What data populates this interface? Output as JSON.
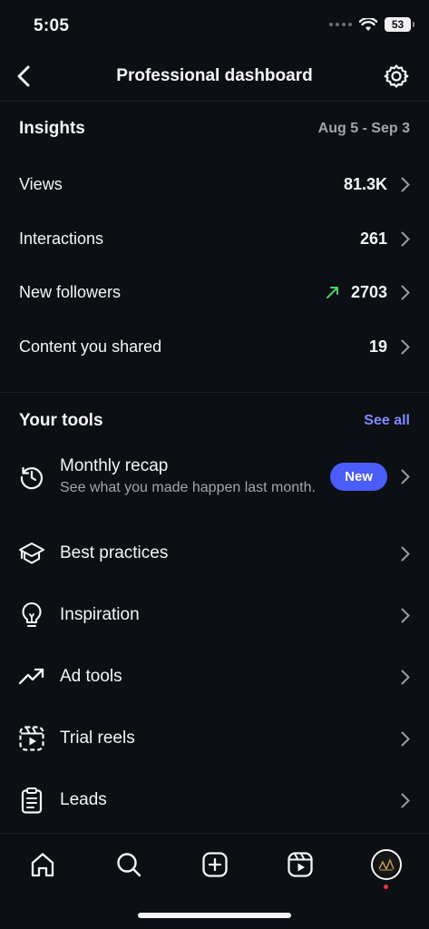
{
  "status_bar": {
    "time": "5:05",
    "battery": "53"
  },
  "header": {
    "title": "Professional dashboard"
  },
  "insights": {
    "title": "Insights",
    "date_range": "Aug 5 - Sep 3",
    "metrics": [
      {
        "label": "Views",
        "value": "81.3K"
      },
      {
        "label": "Interactions",
        "value": "261"
      },
      {
        "label": "New followers",
        "value": "2703",
        "trend": "up"
      },
      {
        "label": "Content you shared",
        "value": "19"
      }
    ]
  },
  "tools": {
    "title": "Your tools",
    "see_all": "See all",
    "items": [
      {
        "label": "Monthly recap",
        "subtitle": "See what you made happen last month.",
        "badge": "New",
        "icon": "history-icon"
      },
      {
        "label": "Best practices",
        "icon": "graduation-cap-icon"
      },
      {
        "label": "Inspiration",
        "icon": "lightbulb-icon"
      },
      {
        "label": "Ad tools",
        "icon": "trending-up-icon"
      },
      {
        "label": "Trial reels",
        "icon": "reels-dashed-icon"
      },
      {
        "label": "Leads",
        "icon": "clipboard-icon"
      }
    ]
  },
  "colors": {
    "accent": "#4a5df9",
    "link": "#7f8cff",
    "trend_up": "#4ad36b",
    "background": "#0c0f14"
  }
}
